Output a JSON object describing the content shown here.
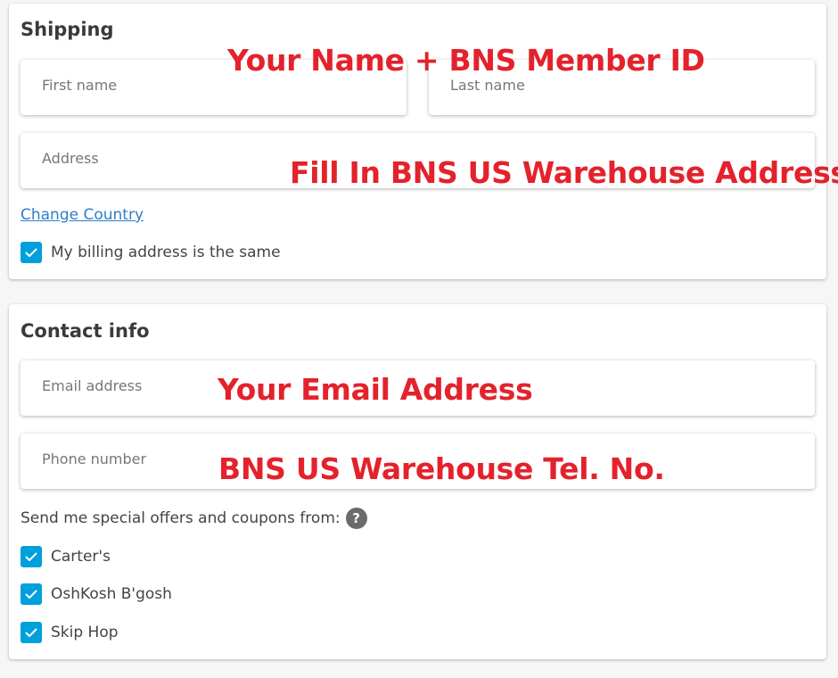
{
  "shipping": {
    "title": "Shipping",
    "first_name": {
      "placeholder": "First name",
      "value": ""
    },
    "last_name": {
      "placeholder": "Last name",
      "value": ""
    },
    "address": {
      "placeholder": "Address",
      "value": ""
    },
    "change_country_link": "Change Country",
    "billing_same": {
      "label": "My billing address is the same",
      "checked": true
    }
  },
  "contact": {
    "title": "Contact info",
    "email": {
      "placeholder": "Email address",
      "value": ""
    },
    "phone": {
      "placeholder": "Phone number",
      "value": ""
    },
    "offers_label": "Send me special offers and coupons from:",
    "help_glyph": "?",
    "brands": [
      {
        "label": "Carter's",
        "checked": true
      },
      {
        "label": "OshKosh B'gosh",
        "checked": true
      },
      {
        "label": "Skip Hop",
        "checked": true
      }
    ]
  },
  "annotations": {
    "name_note": "Your Name + BNS Member ID",
    "address_note": "Fill In BNS US Warehouse Address",
    "email_note": "Your Email Address",
    "phone_note": "BNS US Warehouse Tel. No."
  },
  "colors": {
    "accent": "#00a0dc",
    "link": "#2d7fc6",
    "annotation": "#e3222c",
    "background": "#f6f6f6"
  },
  "icons": {
    "checkbox": "check-icon",
    "help": "question-icon"
  }
}
